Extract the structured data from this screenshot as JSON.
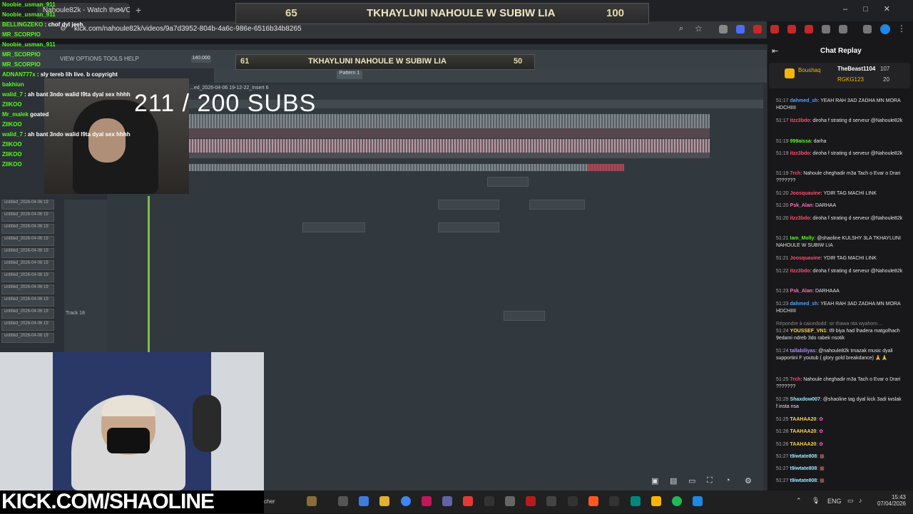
{
  "browser": {
    "tab_title": "Nahoule82k - Watch the VOD",
    "url": "kick.com/nahoule82k/videos/9a7d3952-804b-4a6c-986e-6516b34b8265"
  },
  "top_banner": {
    "left": "65",
    "title": "TKHAYLUNI NAHOULE W SUBIW LIA",
    "right": "100"
  },
  "fl_banner": {
    "left": "61",
    "title": "TKHAYLUNI NAHOULE W SUBIW LIA",
    "right": "50"
  },
  "fl_menu_text": "VIEW OPTIONS TOOLS HELP",
  "fl_pattern": "Pattern 1",
  "fl_clip_title": "...ed_2026-04-06 19-12-22_Insert 6",
  "fl_track_label": "Track 18",
  "track_names": [
    "untitled_2026-04-06 19",
    "untitled_2026-04-06 19",
    "untitled_2026-04-06 19",
    "untitled_2026-04-06 19",
    "untitled_2026-04-06 19",
    "untitled_2026-04-06 19",
    "untitled_2026-04-06 19",
    "untitled_2026-04-06 19",
    "untitled_2026-04-06 19",
    "untitled_2026-04-06 19",
    "untitled_2026-04-06 19",
    "untitled_2026-04-06 19"
  ],
  "overlay_chat": [
    {
      "name": "Noobie_usman_911",
      "text": ""
    },
    {
      "name": "Noobie_usman_911",
      "text": ""
    },
    {
      "name": "BELLINGZEKO",
      "text": "chof dyl jeeh"
    },
    {
      "name": "MR_SCORPIO",
      "text": ""
    },
    {
      "name": "Noobie_usman_911",
      "text": ""
    },
    {
      "name": "MR_SCORPIO",
      "text": ""
    },
    {
      "name": "MR_SCORPIO",
      "text": ""
    },
    {
      "name": "ADNAN777x",
      "text": "sly tereb lih live. b copyright"
    },
    {
      "name": "bakhiun",
      "text": ""
    },
    {
      "name": "walid_7",
      "text": "ah bant 3ndo walid l9ta dyal sex hhhh"
    },
    {
      "name": "ZIIKOO",
      "text": ""
    },
    {
      "name": "Mr_malek",
      "text": "goated"
    },
    {
      "name": "ZIIKOO",
      "text": ""
    },
    {
      "name": "walid_7",
      "text": "ah bant 3ndo walid l9ta dyal sex hhhh"
    },
    {
      "name": "ZIIKOO",
      "text": ""
    },
    {
      "name": "ZIIKOO",
      "text": ""
    },
    {
      "name": "ZIIKOO",
      "text": ""
    }
  ],
  "subs_counter": "211 / 200  SUBS",
  "kick_text": "KICK.COM/SHAOLINE",
  "chat": {
    "title": "Chat Replay",
    "pinned": {
      "user1": "Boushaq",
      "user2": "TheBeast1104",
      "count1": "107",
      "user3": "RGKG123",
      "count2": "20"
    },
    "messages": [
      {
        "time": "51:17",
        "user": "dahmed_sh",
        "color": "#4fa3ff",
        "text": "YEAH RAH 3AD ZADHA MN MORA HDCHIIII"
      },
      {
        "time": "51:17",
        "user": "itzz3bdo",
        "color": "#ff4d6d",
        "text": "diroha f strating d serveur @Nahoule82k"
      },
      {
        "time": "51:19",
        "user": "999aissa",
        "color": "#53fc18",
        "text": "darha"
      },
      {
        "time": "51:19",
        "user": "itzz3bdo",
        "color": "#ff4d6d",
        "text": "diroha f strating d serveur @Nahoule82k"
      },
      {
        "time": "51:19",
        "user": "7rch",
        "color": "#ff4d6d",
        "text": "Nahoule cheghadir m3a Tach o Evar o Drari ???????"
      },
      {
        "time": "51:20",
        "user": "Joosquauine",
        "color": "#ff4d6d",
        "text": "YDIR TAG MACHI LINK"
      },
      {
        "time": "51:20",
        "user": "Psk_Alan",
        "color": "#ff6fb5",
        "text": "DARHAA"
      },
      {
        "time": "51:20",
        "user": "itzz3bdo",
        "color": "#ff4d6d",
        "text": "diroha f strating d serveur @Nahoule82k"
      },
      {
        "time": "51:21",
        "user": "Iam_Molly",
        "color": "#53fc18",
        "text": "@shaoline KULSHY 3LA TKHAYLUNI NAHOULE W SUBIW LIA"
      },
      {
        "time": "51:21",
        "user": "Joosquauine",
        "color": "#ff4d6d",
        "text": "YDIR TAG MACHI LINK"
      },
      {
        "time": "51:22",
        "user": "itzz3bdo",
        "color": "#ff4d6d",
        "text": "diroha f strating d serveur @Nahoule82k"
      },
      {
        "time": "51:23",
        "user": "Psk_Alan",
        "color": "#ff6fb5",
        "text": "DARHAAA"
      },
      {
        "time": "51:23",
        "user": "dahmed_sh",
        "color": "#4fa3ff",
        "text": "YEAH RAH 3AD ZADHA MN MORA HDCHIIII"
      },
      {
        "time": "",
        "user": "",
        "color": "#888888",
        "text": "Répondre à caicedodd: sir thawa nta wyahom ..."
      },
      {
        "time": "51:24",
        "user": "YOUSSEF_VN1",
        "color": "#ffd54f",
        "text": "tl9 biya had lhadera matgolhach 9edami ndreb 3do rabek nsotik"
      },
      {
        "time": "51:24",
        "user": "tallabiliyas",
        "color": "#b388ff",
        "text": "@nahoule82k tmazak music dyali supportini F youtub ( glory gold breakdance) 🙏🙏"
      },
      {
        "time": "51:25",
        "user": "7rch",
        "color": "#ff4d6d",
        "text": "Nahoule cheghadir m3a Tach o Evar o Drari ???????"
      },
      {
        "time": "51:25",
        "user": "Shaxdow007",
        "color": "#9be7ff",
        "text": "@shaoline tag dyal kick 3adi iwslak f insta nsa"
      },
      {
        "time": "51:25",
        "user": "TAAHAA20",
        "color": "#ffd54f",
        "text": ""
      },
      {
        "time": "51:26",
        "user": "TAAHAA20",
        "color": "#ffd54f",
        "text": ""
      },
      {
        "time": "51:26",
        "user": "TAAHAA20",
        "color": "#ffd54f",
        "text": ""
      },
      {
        "time": "51:27",
        "user": "t9iwtate808",
        "color": "#9be7ff",
        "text": ""
      },
      {
        "time": "51:27",
        "user": "t9iwtate808",
        "color": "#9be7ff",
        "text": ""
      },
      {
        "time": "51:27",
        "user": "t9iwtate808",
        "color": "#9be7ff",
        "text": ""
      }
    ]
  },
  "taskbar": {
    "search": "cher",
    "lang": "ENG",
    "time": "15:43",
    "date": "07/04/2026"
  }
}
